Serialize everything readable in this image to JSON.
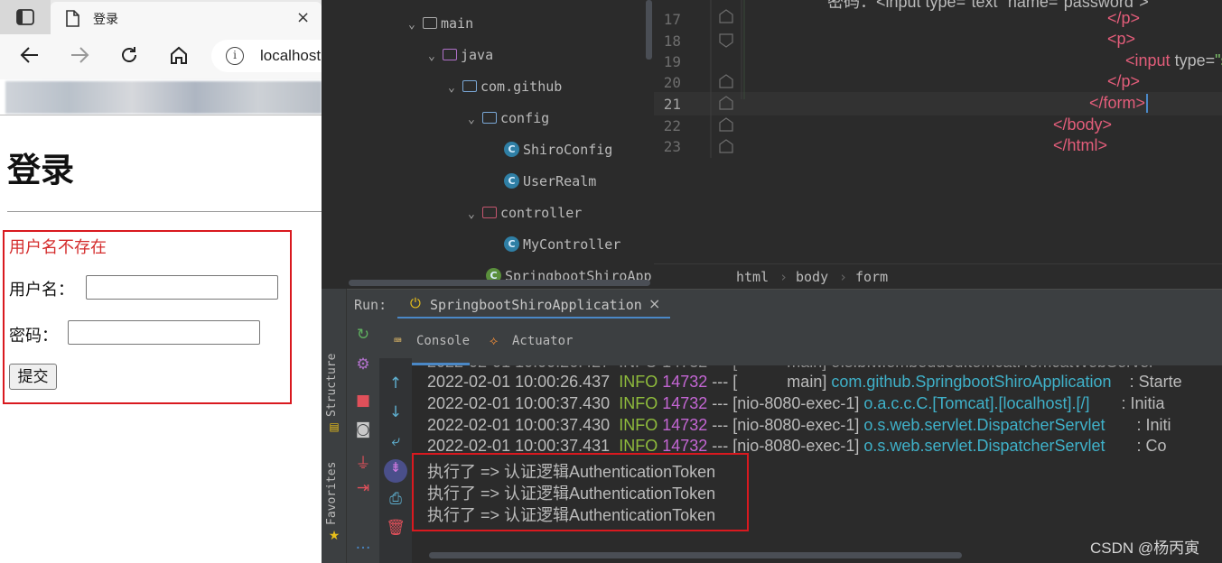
{
  "browser": {
    "tab_title": "登录",
    "tab_close": "×",
    "address": "localhost",
    "info_icon": "i",
    "page": {
      "heading": "登录",
      "error": "用户名不存在",
      "username_label": "用户名：",
      "password_label": "密码：",
      "submit": "提交"
    }
  },
  "project_tree": {
    "items": [
      {
        "label": "main",
        "icon": "folder-icon",
        "expanded": true
      },
      {
        "label": "java",
        "icon": "source-folder-icon",
        "expanded": true
      },
      {
        "label": "com.github",
        "icon": "package-icon",
        "expanded": true
      },
      {
        "label": "config",
        "icon": "package-icon",
        "expanded": true
      },
      {
        "label": "ShiroConfig",
        "icon": "class-icon"
      },
      {
        "label": "UserRealm",
        "icon": "class-icon"
      },
      {
        "label": "controller",
        "icon": "package-icon",
        "expanded": true
      },
      {
        "label": "MyController",
        "icon": "class-icon"
      },
      {
        "label": "SpringbootShiroApp",
        "icon": "spring-app-icon"
      }
    ]
  },
  "editor": {
    "line_numbers": [
      "17",
      "18",
      "19",
      "20",
      "21",
      "22",
      "23"
    ],
    "lines": {
      "l16": "密码：<input type=\"text\" name=\"password\">",
      "l17": "</p>",
      "l18": "<p>",
      "l19": "<input type=\"submit\">",
      "l20": "</p>",
      "l21": "</form>",
      "l22": "</body>",
      "l23": "</html>"
    },
    "breadcrumb": [
      "html",
      "body",
      "form"
    ]
  },
  "run": {
    "label": "Run:",
    "tab": "SpringbootShiroApplication",
    "close": "×",
    "console_tab": "Console",
    "actuator_tab": "Actuator",
    "vertical_tabs": [
      "Structure",
      "Favorites"
    ]
  },
  "console_log": [
    {
      "time": "2022-02-01 10:00:26.437",
      "level": "INFO",
      "pid": "14732",
      "sep": "---",
      "thread": "[           main]",
      "logger": "com.github.SpringbootShiroApplication",
      "msg": ": Starte"
    },
    {
      "time": "2022-02-01 10:00:37.430",
      "level": "INFO",
      "pid": "14732",
      "sep": "---",
      "thread": "[nio-8080-exec-1]",
      "logger": "o.a.c.c.C.[Tomcat].[localhost].[/]",
      "msg": ": Initia"
    },
    {
      "time": "2022-02-01 10:00:37.430",
      "level": "INFO",
      "pid": "14732",
      "sep": "---",
      "thread": "[nio-8080-exec-1]",
      "logger": "o.s.web.servlet.DispatcherServlet",
      "msg": ": Initi"
    },
    {
      "time": "2022-02-01 10:00:37.431",
      "level": "INFO",
      "pid": "14732",
      "sep": "---",
      "thread": "[nio-8080-exec-1]",
      "logger": "o.s.web.servlet.DispatcherServlet",
      "msg": ": Co"
    }
  ],
  "console_output": [
    "执行了 => 认证逻辑AuthenticationToken",
    "执行了 => 认证逻辑AuthenticationToken",
    "执行了 => 认证逻辑AuthenticationToken"
  ],
  "watermark": "CSDN @杨丙寅",
  "colors": {
    "highlight_border": "#d9191f",
    "error_text": "#d42c2c",
    "log_info": "#8fbc3c",
    "log_pid": "#c466d4",
    "log_class": "#3fb1c9",
    "tab_underline": "#4a88c7"
  }
}
